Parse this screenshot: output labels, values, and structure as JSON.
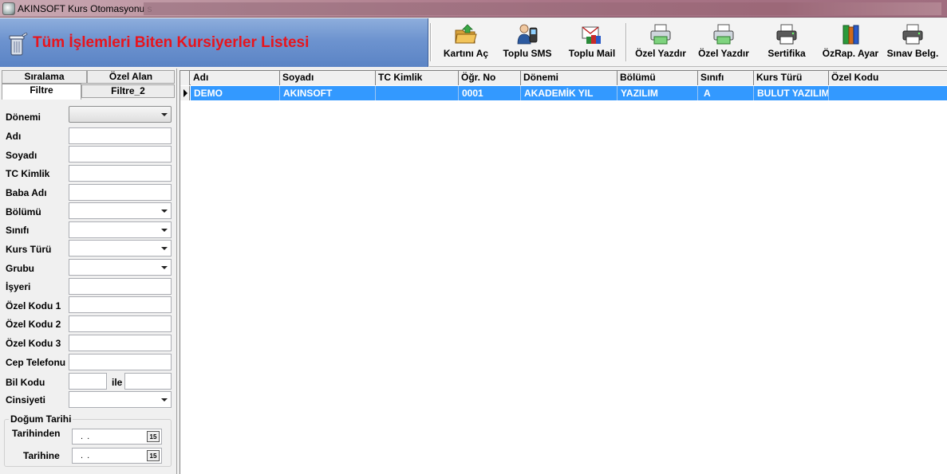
{
  "window": {
    "title": "AKINSOFT Kurs Otomasyonu s"
  },
  "banner": {
    "title": "Tüm İşlemleri Biten Kursiyerler Listesi"
  },
  "toolbar": {
    "buttons": [
      {
        "label": "Kartını Aç",
        "icon": "folder-open-icon"
      },
      {
        "label": "Toplu SMS",
        "icon": "phone-user-icon"
      },
      {
        "label": "Toplu Mail",
        "icon": "mail-books-icon"
      },
      {
        "label": "Özel Yazdır",
        "icon": "printer-green-icon"
      },
      {
        "label": "Özel Yazdır",
        "icon": "printer-green-icon"
      },
      {
        "label": "Sertifika",
        "icon": "printer-icon"
      },
      {
        "label": "ÖzRap. Ayar",
        "icon": "books-icon"
      },
      {
        "label": "Sınav Belg.",
        "icon": "printer-icon"
      }
    ]
  },
  "tabs": {
    "top_left": "Sıralama",
    "top_right": "Özel Alan",
    "bottom_left": "Filtre",
    "bottom_right": "Filtre_2"
  },
  "filter": {
    "donemi": "Dönemi",
    "adi": "Adı",
    "soyadi": "Soyadı",
    "tc": "TC Kimlik",
    "baba": "Baba Adı",
    "bolumu": "Bölümü",
    "sinifi": "Sınıfı",
    "kurs_turu": "Kurs Türü",
    "grubu": "Grubu",
    "isyeri": "İşyeri",
    "ozel1": "Özel Kodu 1",
    "ozel2": "Özel Kodu 2",
    "ozel3": "Özel Kodu 3",
    "cep": "Cep Telefonu",
    "bil_kodu": "Bil Kodu",
    "ile": "ile",
    "cinsiyeti": "Cinsiyeti",
    "dogum_group": "Doğum Tarihi",
    "tarihinden": "Tarihinden",
    "tarihine": "Tarihine",
    "date_placeholder": ". .",
    "calendar_glyph": "15"
  },
  "grid": {
    "columns": [
      "Adı",
      "Soyadı",
      "TC Kimlik",
      "Öğr. No",
      "Dönemi",
      "Bölümü",
      "Sınıfı",
      "Kurs Türü",
      "Özel Kodu"
    ],
    "rows": [
      [
        "DEMO",
        "AKINSOFT",
        "",
        "0001",
        "AKADEMİK YIL",
        "YAZILIM",
        "A",
        "BULUT YAZILIM",
        ""
      ]
    ]
  },
  "colors": {
    "selection": "#3399ff",
    "banner_title": "#e8141c",
    "banner_bg": "#6d93cf"
  }
}
